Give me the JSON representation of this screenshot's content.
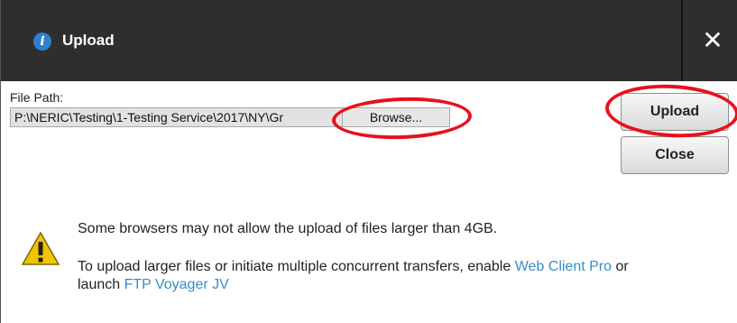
{
  "dialog": {
    "title": "Upload",
    "title_icon": "info-icon",
    "close_icon": "close-x-icon",
    "close_glyph": "✕"
  },
  "file_path": {
    "label": "File Path:",
    "value": "P:\\NERIC\\Testing\\1-Testing Service\\2017\\NY\\Gr",
    "browse_label": "Browse..."
  },
  "buttons": {
    "upload_label": "Upload",
    "close_label": "Close"
  },
  "warning": {
    "icon": "warning-icon",
    "line1": "Some browsers may not allow the upload of files larger than 4GB.",
    "line2_prefix": "To upload larger files or initiate multiple concurrent transfers, enable ",
    "link1": "Web Client Pro",
    "line2_middle": " or launch ",
    "link2": "FTP Voyager JV"
  },
  "colors": {
    "titlebar": "#2e2e2e",
    "link": "#3a8cc4",
    "annotation": "#e8101e"
  }
}
